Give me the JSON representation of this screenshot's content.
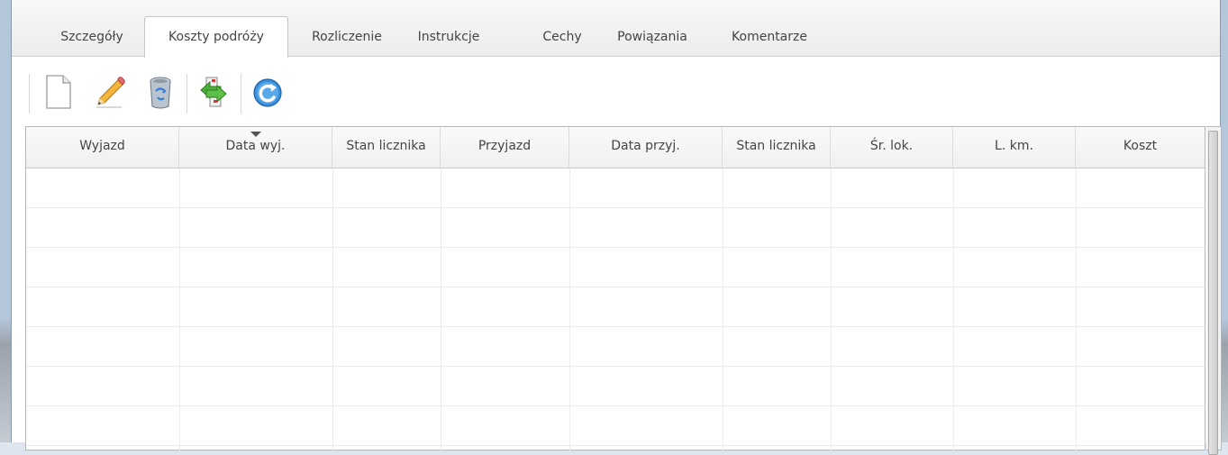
{
  "tabs": [
    {
      "label": "Szczegóły",
      "active": false
    },
    {
      "label": "Koszty podróży",
      "active": true
    },
    {
      "label": "Rozliczenie",
      "active": false
    },
    {
      "label": "Instrukcje",
      "active": false
    },
    {
      "label": "Cechy",
      "active": false
    },
    {
      "label": "Powiązania",
      "active": false
    },
    {
      "label": "Komentarze",
      "active": false
    }
  ],
  "toolbar": {
    "buttons": [
      {
        "icon": "new-document-icon"
      },
      {
        "icon": "edit-pencil-icon"
      },
      {
        "icon": "recycle-bin-icon"
      },
      {
        "icon": "transfer-arrows-icon"
      },
      {
        "icon": "refresh-icon"
      }
    ]
  },
  "grid": {
    "columns": [
      "Wyjazd",
      "Data wyj.",
      "Stan licznika",
      "Przyjazd",
      "Data przyj.",
      "Stan licznika",
      "Śr. lok.",
      "L. km.",
      "Koszt"
    ],
    "sorted_column": "Data wyj.",
    "sort_direction": "descending",
    "rows": []
  },
  "colors": {
    "accent": "#3a8fd8",
    "icon_green": "#4caf3a"
  }
}
